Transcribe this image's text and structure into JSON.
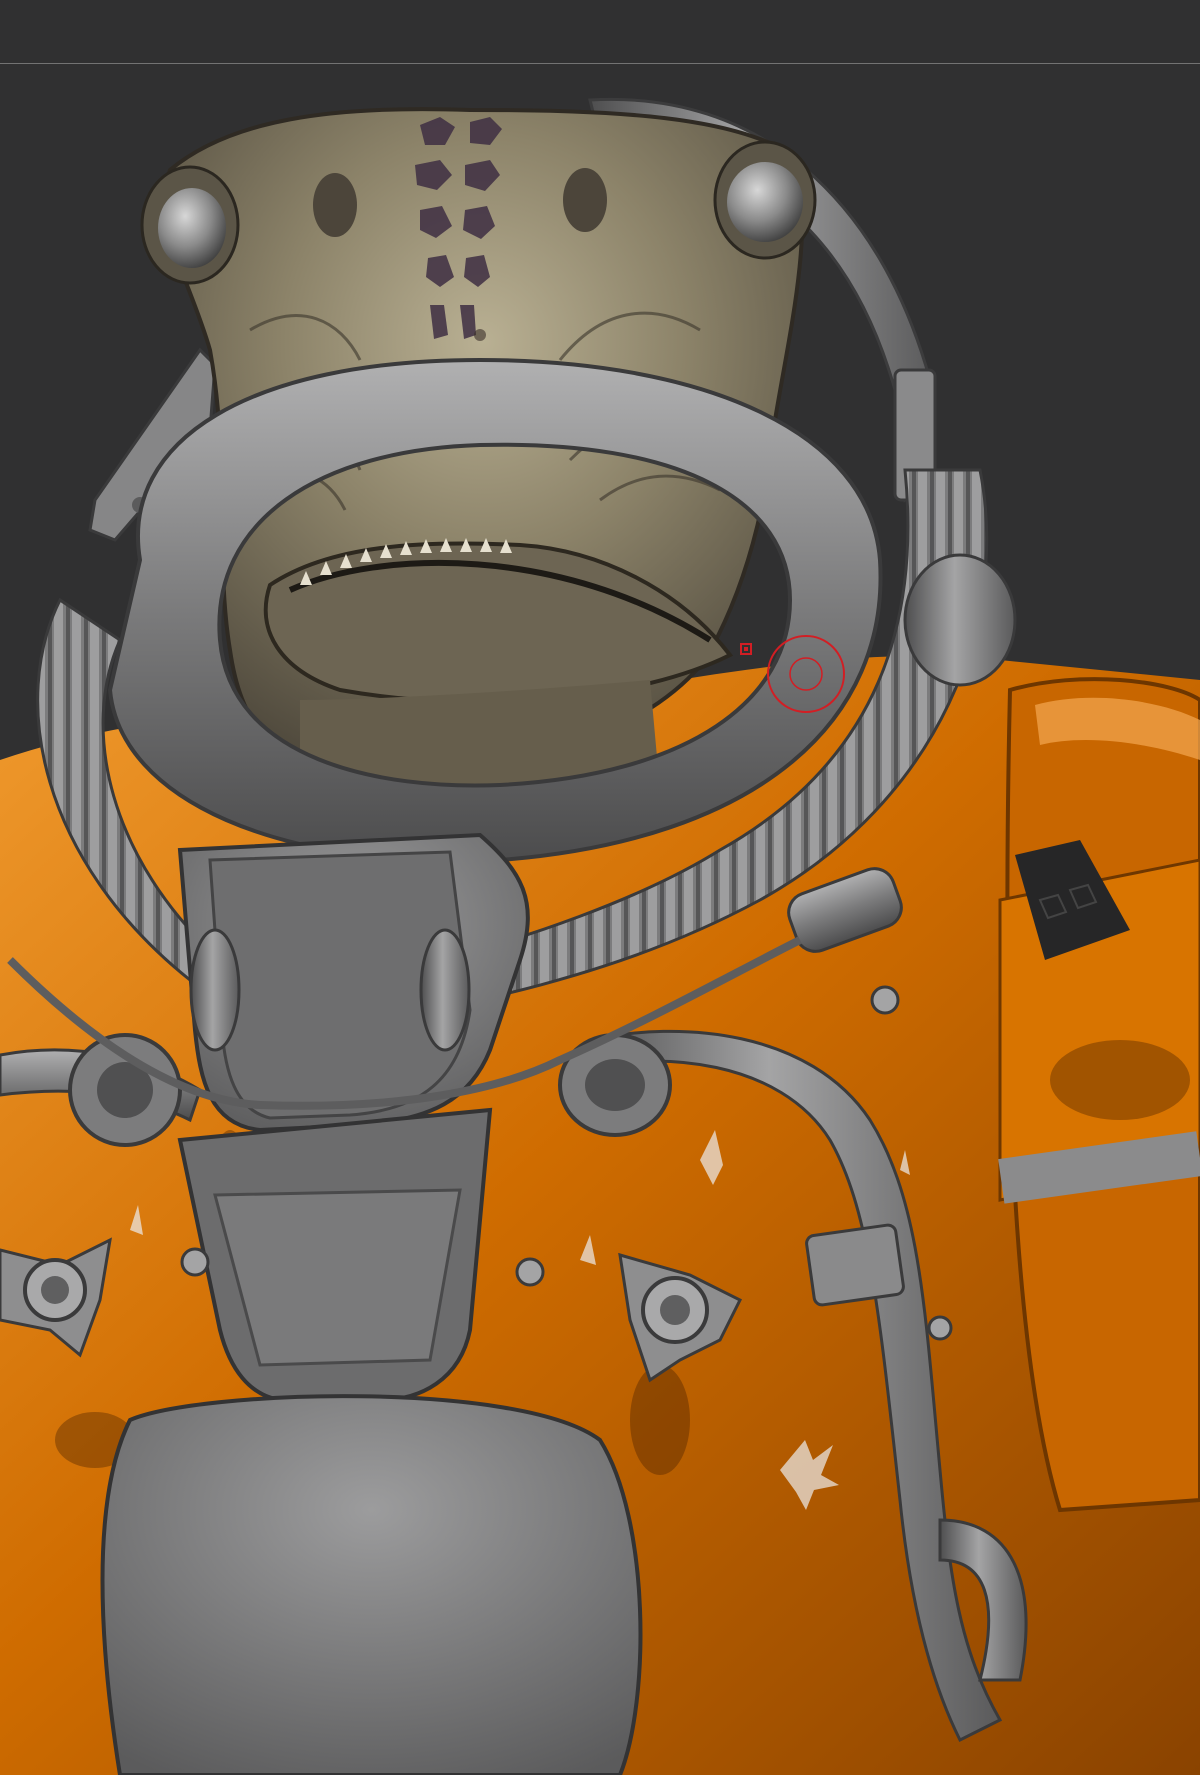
{
  "viewport": {
    "background": "#303031",
    "guide_color": "#8a8a8a"
  },
  "scene": {
    "subject": "creature-spacesuit-sculpt",
    "materials": {
      "skin": "#7b725f",
      "skin_light": "#b3aa8e",
      "skin_spots": "#3e2f3f",
      "suit_orange": "#d27200",
      "suit_orange_light": "#f0a14a",
      "metal_gray": "#777778",
      "metal_light": "#a7a7a8",
      "metal_dark": "#4a4a4b"
    }
  },
  "brush_cursor": {
    "color": "#d21e24",
    "icon": "brush-circle-cursor"
  }
}
